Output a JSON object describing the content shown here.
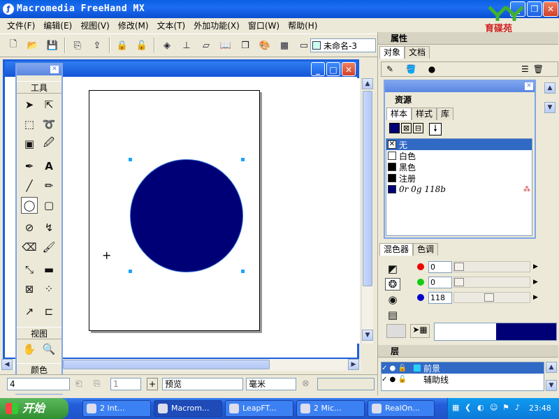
{
  "window": {
    "title": "Macromedia FreeHand MX",
    "logo_text": "育碟苑"
  },
  "menu": [
    "文件(F)",
    "编辑(E)",
    "视图(V)",
    "修改(M)",
    "文本(T)",
    "外加功能(X)",
    "窗口(W)",
    "帮助(H)"
  ],
  "toolbar": {
    "document_name": "未命名-3"
  },
  "tools": {
    "section_tools": "工具",
    "section_view": "视图",
    "section_color": "颜色"
  },
  "properties": {
    "title": "属性",
    "tabs": [
      "对象",
      "文档"
    ]
  },
  "assets": {
    "title": "资源",
    "tabs": [
      "样本",
      "样式",
      "库"
    ],
    "swatches": [
      {
        "label": "无",
        "color": "none"
      },
      {
        "label": "白色",
        "color": "#ffffff"
      },
      {
        "label": "黑色",
        "color": "#000000"
      },
      {
        "label": "注册",
        "color": "#000000"
      },
      {
        "label": "0r 0g 118b",
        "color": "#000076"
      }
    ]
  },
  "mixer": {
    "tabs": [
      "混色器",
      "色调"
    ],
    "r": "0",
    "g": "0",
    "b": "118",
    "r_frac": 0.0,
    "g_frac": 0.0,
    "b_frac": 0.46,
    "color": "#000076"
  },
  "layers": {
    "title": "层",
    "items": [
      "前景",
      "辅助线"
    ]
  },
  "status": {
    "zoom": "4",
    "page": "1",
    "view_mode": "预览",
    "units": "毫米"
  },
  "taskbar": {
    "start": "开始",
    "tasks": [
      "2 Int...",
      "Macrom...",
      "LeapFT...",
      "2 Mic...",
      "RealOn..."
    ],
    "time": "23:48"
  },
  "colors": {
    "circle_fill": "#000076",
    "selection": "#316ac5"
  }
}
